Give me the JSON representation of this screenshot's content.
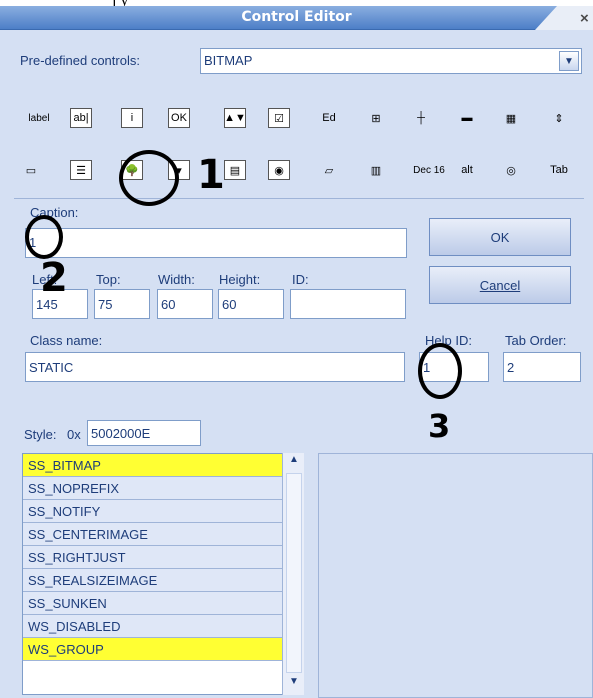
{
  "header_fragment": "j    y",
  "window": {
    "title": "Control Editor",
    "close": "×"
  },
  "predefined": {
    "label": "Pre-defined controls:",
    "value": "BITMAP"
  },
  "toolbar": {
    "row1": [
      {
        "icon": "label-tool-icon",
        "glyph": "label"
      },
      {
        "icon": "edit-tool-icon",
        "glyph": "ab|"
      },
      {
        "icon": "info-tool-icon",
        "glyph": "i"
      },
      {
        "icon": "button-tool-icon",
        "glyph": "OK"
      },
      {
        "icon": "spin-tool-icon",
        "glyph": "▲▼"
      },
      {
        "icon": "checkbox-tool-icon",
        "glyph": "☑"
      },
      {
        "icon": "richedit-tool-icon",
        "glyph": "Ed"
      },
      {
        "icon": "treeview-tool-icon",
        "glyph": "⊞"
      },
      {
        "icon": "slider-tool-icon",
        "glyph": "┼"
      },
      {
        "icon": "progress-tool-icon",
        "glyph": "▬"
      },
      {
        "icon": "calendar-tool-icon",
        "glyph": "▦"
      },
      {
        "icon": "updown-tool-icon",
        "glyph": "⇕"
      }
    ],
    "row2": [
      {
        "icon": "groupbox-tool-icon",
        "glyph": "▭"
      },
      {
        "icon": "listbox-tool-icon",
        "glyph": "☰"
      },
      {
        "icon": "picture-tool-icon",
        "glyph": "🌳"
      },
      {
        "icon": "combobox-tool-icon",
        "glyph": "▾"
      },
      {
        "icon": "listview-tool-icon",
        "glyph": "▤"
      },
      {
        "icon": "radio-tool-icon",
        "glyph": "◉"
      },
      {
        "icon": "shape-tool-icon",
        "glyph": "▱"
      },
      {
        "icon": "listctrl-tool-icon",
        "glyph": "▥"
      },
      {
        "icon": "dec-tool-icon",
        "glyph": "Dec 16"
      },
      {
        "icon": "alt-tool-icon",
        "glyph": "alt"
      },
      {
        "icon": "animation-tool-icon",
        "glyph": "◎"
      },
      {
        "icon": "tab-tool-icon",
        "glyph": "Tab"
      }
    ]
  },
  "caption": {
    "label": "Caption:",
    "value": "1"
  },
  "geometry": {
    "left_label": "Left:",
    "left_value": "145",
    "top_label": "Top:",
    "top_value": "75",
    "width_label": "Width:",
    "width_value": "60",
    "height_label": "Height:",
    "height_value": "60",
    "id_label": "ID:",
    "id_value": ""
  },
  "buttons": {
    "ok": "OK",
    "cancel": "Cancel"
  },
  "classname": {
    "label": "Class name:",
    "value": "STATIC"
  },
  "help_id": {
    "label": "Help ID:",
    "value": "1"
  },
  "tab_order": {
    "label": "Tab Order:",
    "value": "2"
  },
  "style": {
    "label": "Style:",
    "prefix": "0x",
    "value": "5002000E"
  },
  "style_list": [
    {
      "label": "SS_BITMAP",
      "selected": true
    },
    {
      "label": "SS_NOPREFIX",
      "selected": false
    },
    {
      "label": "SS_NOTIFY",
      "selected": false
    },
    {
      "label": "SS_CENTERIMAGE",
      "selected": false
    },
    {
      "label": "SS_RIGHTJUST",
      "selected": false
    },
    {
      "label": "SS_REALSIZEIMAGE",
      "selected": false
    },
    {
      "label": "SS_SUNKEN",
      "selected": false
    },
    {
      "label": "WS_DISABLED",
      "selected": false
    },
    {
      "label": "WS_GROUP",
      "selected": true
    }
  ],
  "annotations": {
    "one": "1",
    "two": "2",
    "three": "3"
  },
  "colors": {
    "accent": "#4d7fc7",
    "client": "#d5e0f3",
    "highlight": "#ffff33"
  }
}
